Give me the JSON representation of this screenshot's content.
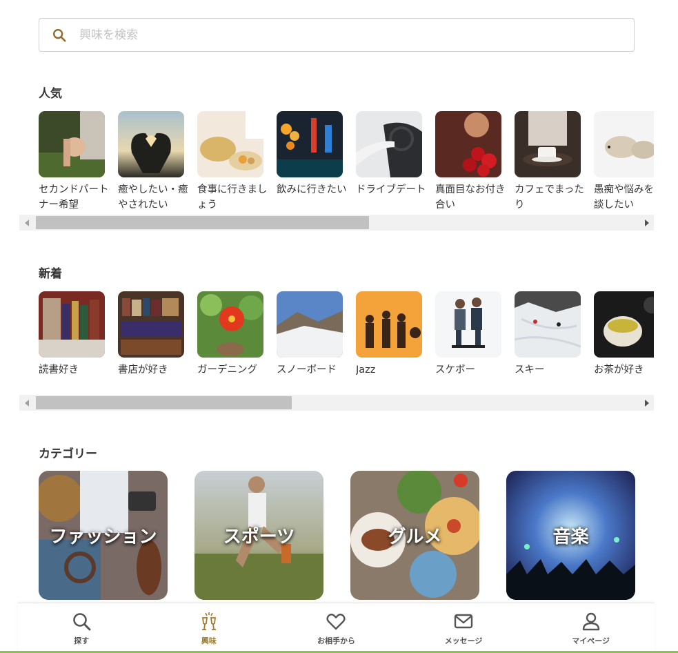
{
  "search": {
    "placeholder": "興味を検索",
    "icon": "search-icon",
    "accent": "#8c6d2c"
  },
  "popular": {
    "title": "人気",
    "items": [
      {
        "label": "セカンドパートナー希望"
      },
      {
        "label": "癒やしたい・癒やされたい"
      },
      {
        "label": "食事に行きましょう"
      },
      {
        "label": "飲みに行きたい"
      },
      {
        "label": "ドライブデート"
      },
      {
        "label": "真面目なお付き合い"
      },
      {
        "label": "カフェでまったり"
      },
      {
        "label": "愚痴や悩みを相談したい"
      }
    ]
  },
  "newest": {
    "title": "新着",
    "items": [
      {
        "label": "読書好き"
      },
      {
        "label": "書店が好き"
      },
      {
        "label": "ガーデニング"
      },
      {
        "label": "スノーボード"
      },
      {
        "label": "Jazz"
      },
      {
        "label": "スケボー"
      },
      {
        "label": "スキー"
      },
      {
        "label": "お茶が好き"
      }
    ]
  },
  "categories": {
    "title": "カテゴリー",
    "items": [
      {
        "label": "ファッション"
      },
      {
        "label": "スポーツ"
      },
      {
        "label": "グルメ"
      },
      {
        "label": "音楽"
      }
    ]
  },
  "tabbar": {
    "items": [
      {
        "label": "探す",
        "icon": "search-icon"
      },
      {
        "label": "興味",
        "icon": "toast-glasses-icon",
        "active": true
      },
      {
        "label": "お相手から",
        "icon": "heart-icon"
      },
      {
        "label": "メッセージ",
        "icon": "envelope-icon"
      },
      {
        "label": "マイページ",
        "icon": "person-icon"
      }
    ],
    "active_color": "#a07a28"
  }
}
